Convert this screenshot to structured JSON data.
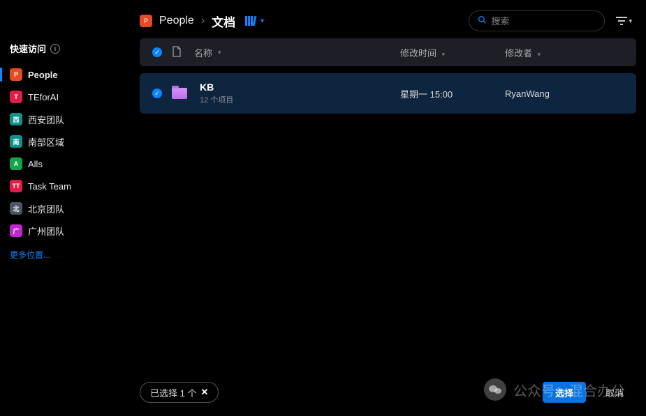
{
  "sidebar": {
    "header": "快速访问",
    "more": "更多位置...",
    "items": [
      {
        "label": "People",
        "badge": "P",
        "color": "#e64b23",
        "active": true
      },
      {
        "label": "TEforAI",
        "badge": "T",
        "color": "#e11d48",
        "active": false
      },
      {
        "label": "西安团队",
        "badge": "西",
        "color": "#0d9488",
        "active": false
      },
      {
        "label": "南部区域",
        "badge": "南",
        "color": "#0d9488",
        "active": false
      },
      {
        "label": "Alls",
        "badge": "A",
        "color": "#16a34a",
        "active": false
      },
      {
        "label": "Task Team",
        "badge": "TT",
        "color": "#e11d48",
        "active": false
      },
      {
        "label": "北京团队",
        "badge": "北",
        "color": "#4b5563",
        "active": false
      },
      {
        "label": "广州团队",
        "badge": "广",
        "color": "#c026d3",
        "active": false
      }
    ]
  },
  "breadcrumb": {
    "root": "People",
    "current": "文档"
  },
  "search": {
    "placeholder": "搜索"
  },
  "columns": {
    "name": "名称",
    "mtime": "修改时间",
    "user": "修改者"
  },
  "rows": [
    {
      "name": "KB",
      "sub": "12 个项目",
      "mtime": "星期一 15:00",
      "user": "RyanWang",
      "selected": true
    }
  ],
  "footer": {
    "selection": "已选择 1 个",
    "primary": "选择",
    "cancel": "取消"
  },
  "watermark": {
    "text": "公众号：混合办公"
  }
}
